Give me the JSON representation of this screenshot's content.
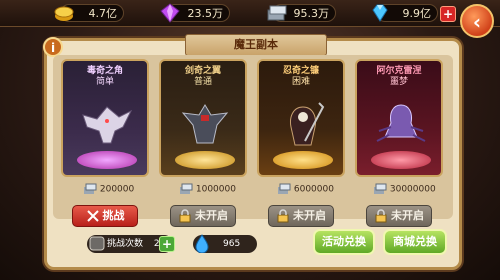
{
  "resources": [
    {
      "icon": "gold-coins-icon",
      "value": "4.7亿"
    },
    {
      "icon": "purple-gem-icon",
      "value": "23.5万"
    },
    {
      "icon": "silver-coins-icon",
      "value": "95.3万"
    },
    {
      "icon": "blue-diamond-icon",
      "value": "9.9亿"
    }
  ],
  "panel": {
    "title": "魔王副本",
    "info": "i"
  },
  "bosses": [
    {
      "name": "毒奇之角",
      "difficulty": "简单",
      "cost": "200000",
      "action": "挑战",
      "locked": false,
      "bg": "#3b2b4b",
      "pedestal": "#d45cc8"
    },
    {
      "name": "剑奇之翼",
      "difficulty": "普通",
      "cost": "1000000",
      "action": "未开启",
      "locked": true,
      "bg": "#3a2a18",
      "pedestal": "#e3b233"
    },
    {
      "name": "忍奇之镰",
      "difficulty": "困难",
      "cost": "6000000",
      "action": "未开启",
      "locked": true,
      "bg": "#3d2510",
      "pedestal": "#f0b82a"
    },
    {
      "name": "阿尔克雷涅",
      "difficulty": "噩梦",
      "cost": "30000000",
      "action": "未开启",
      "locked": true,
      "bg": "#5a1421",
      "pedestal": "#d24055"
    }
  ],
  "bottom": {
    "challenge_label": "挑战次数",
    "challenge_count": "2",
    "plus": "+",
    "water_count": "965",
    "activity_exchange": "活动兑换",
    "shop_exchange": "商城兑换"
  },
  "nav": {
    "back": "‹"
  }
}
